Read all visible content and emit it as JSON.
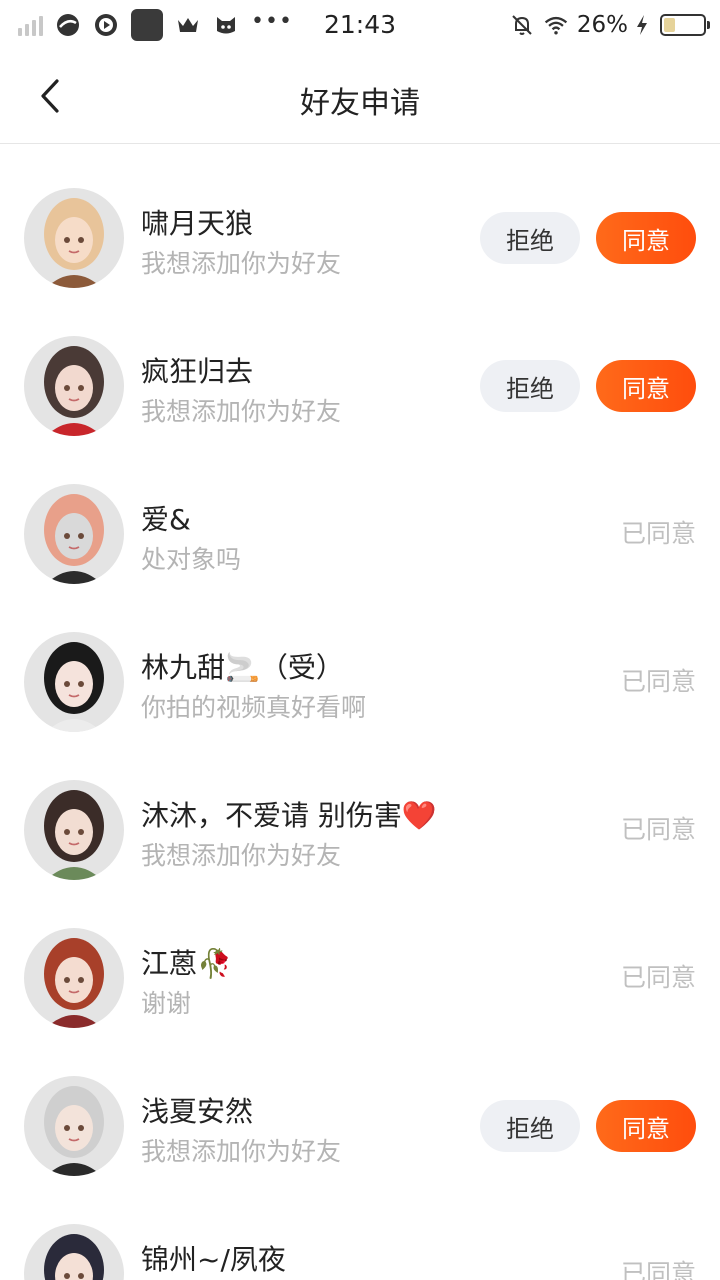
{
  "status_bar": {
    "time": "21:43",
    "battery": "26%"
  },
  "header": {
    "title": "好友申请"
  },
  "labels": {
    "reject": "拒绝",
    "accept": "同意",
    "accepted": "已同意"
  },
  "requests": [
    {
      "name": "啸月天狼",
      "message": "我想添加你为好友",
      "status": "pending",
      "avatar_colors": [
        "#e8c49a",
        "#f6dcc8",
        "#8c5a3a"
      ]
    },
    {
      "name": "疯狂归去",
      "message": "我想添加你为好友",
      "status": "pending",
      "avatar_colors": [
        "#4a3a36",
        "#f2d9cf",
        "#c8262b"
      ]
    },
    {
      "name": "爱&",
      "message": "处对象吗",
      "status": "accepted",
      "avatar_colors": [
        "#e8a08a",
        "#d9d9d9",
        "#2b2b2b"
      ]
    },
    {
      "name": "林九甜🚬（受）",
      "message": "你拍的视频真好看啊",
      "status": "accepted",
      "avatar_colors": [
        "#1a1a1a",
        "#f5e3dc",
        "#ececec"
      ]
    },
    {
      "name": "沐沐，不爱请 别伤害❤️",
      "message": "我想添加你为好友",
      "status": "accepted",
      "avatar_colors": [
        "#3b2c28",
        "#f2ddd2",
        "#6b8a5a"
      ]
    },
    {
      "name": "江蒽🥀",
      "message": "谢谢",
      "status": "accepted",
      "avatar_colors": [
        "#a8402a",
        "#f4dcd0",
        "#8a2b2b"
      ]
    },
    {
      "name": "浅夏安然",
      "message": "我想添加你为好友",
      "status": "pending",
      "avatar_colors": [
        "#cfcfcf",
        "#f3e3da",
        "#2a2a2a"
      ]
    },
    {
      "name": "锦州~/夙夜",
      "message": "",
      "status": "accepted",
      "avatar_colors": [
        "#2a2a3a",
        "#f4e0d6",
        "#e85a8a"
      ]
    }
  ]
}
